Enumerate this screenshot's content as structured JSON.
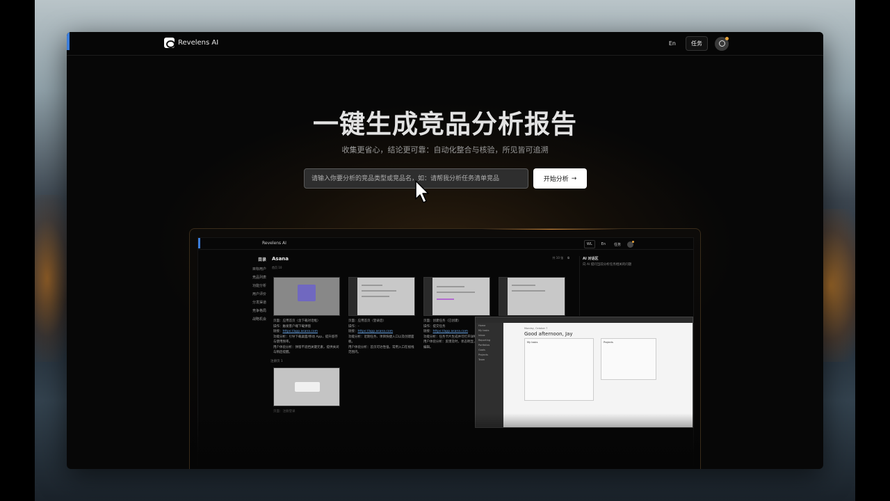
{
  "nav": {
    "brand": "Revelens AI",
    "lang": "En",
    "tasks": "任务"
  },
  "hero": {
    "title": "一键生成竞品分析报告",
    "subtitle": "收集更省心，结论更可靠：自动化整合与核验，所见皆可追溯",
    "input_placeholder": "请输入你要分析的竞品类型或竞品名，如：请帮我分析任务清单竞品",
    "start_button": "开始分析",
    "start_arrow": "→"
  },
  "preview": {
    "brand": "Revelens AI",
    "nav": [
      "WL",
      "En",
      "任务"
    ],
    "toc_title": "目录",
    "toc_items": [
      "目标用户",
      "竞品列表",
      "功能分析",
      "用户评价",
      "分发渠道",
      "竞争格局",
      "战略机会"
    ],
    "app_title": "Asana",
    "crumb": "首页 10",
    "tools": "共 10 张",
    "cards": [
      {
        "page": "页面：应用首页（含下载对话框）",
        "op": "操作：触发客户端下载弹窗",
        "link_label": "链接：",
        "link": "https://app.asana.com",
        "feature": "功能分析：引导下载桌面/移动 App，提升留存与使用频率。",
        "ux": "用户体验分析：弹窗不遮挡关键元素，提供关闭与稍后提醒。"
      },
      {
        "page": "页面：应用首页（登录后）",
        "op": "操作：–",
        "link_label": "链接：",
        "link": "https://app.asana.com",
        "feature": "功能分析：近期任务、项目快捷入口以及创建面板。",
        "ux": "用户体验分析：首页可达性强，常用入口在视线范围内。"
      },
      {
        "page": "页面：创建任务（已创建）",
        "op": "操作：提交任务",
        "link_label": "链接：",
        "link": "https://app.asana.com",
        "feature": "功能分析：任务卡片生成并可打开详细信息。",
        "ux": "用户体验分析：反馈及时，状态明显，便于继续编辑。"
      },
      {
        "page": "",
        "op": "",
        "link_label": "",
        "link": "",
        "feature": "",
        "ux": ""
      }
    ],
    "section2": "注册页 1",
    "card2_text": "页面：注册登录",
    "ai_title": "AI 对话区",
    "ai_desc": "向 AI 提问当前分析任务相关的问题",
    "asana": {
      "sidebar": [
        "Home",
        "My tasks",
        "Inbox",
        "Reporting",
        "Portfolios",
        "Goals",
        "Projects",
        "Team"
      ],
      "date": "Monday, October 7",
      "greeting": "Good afternoon, Jay",
      "my_tasks": "My tasks",
      "projects": "Projects"
    }
  }
}
